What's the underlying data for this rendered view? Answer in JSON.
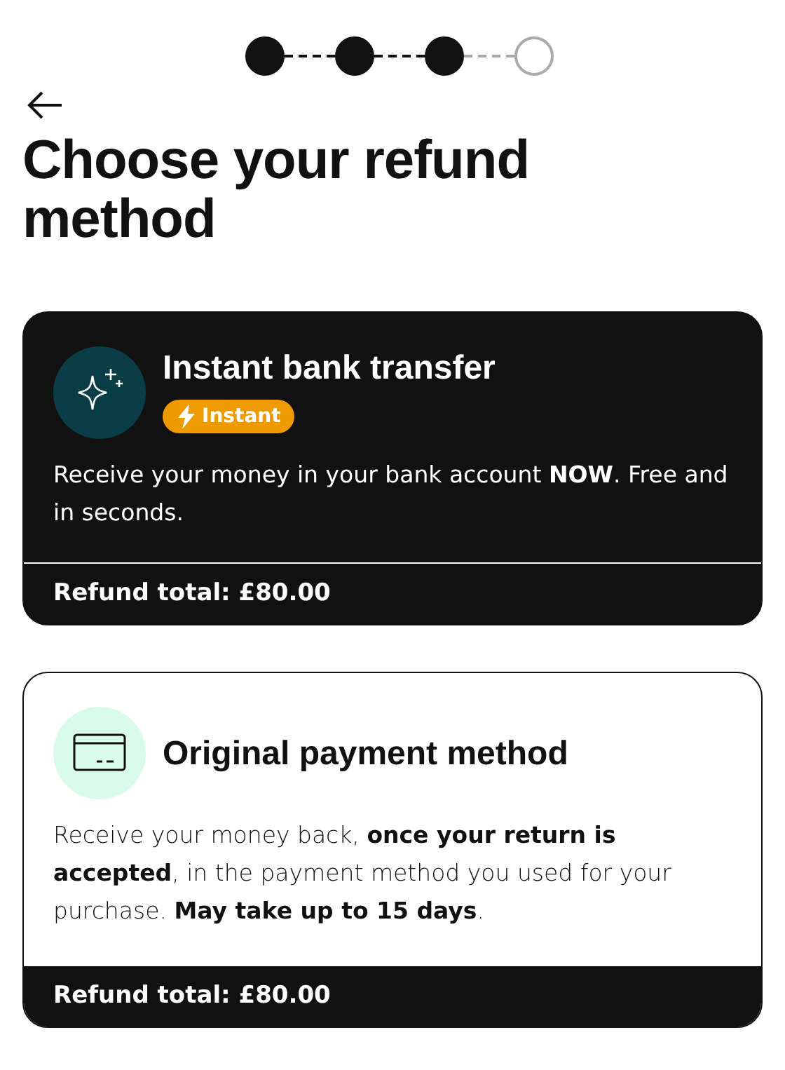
{
  "steps": [
    {
      "done": true
    },
    {
      "done": true
    },
    {
      "done": true
    },
    {
      "done": false
    }
  ],
  "title": "Choose your refund method",
  "options": [
    {
      "kind": "instant",
      "selected": true,
      "title": "Instant bank transfer",
      "badge": "Instant",
      "description": "Receive your money in your bank account **NOW**. Free and in seconds.",
      "total": "Refund total: £80.00"
    },
    {
      "kind": "card",
      "selected": false,
      "title": "Original payment method",
      "description": "Receive your money back, **once your return is accepted**, in the payment method you used for your purchase. **May take up to 15 days**.",
      "total": "Refund total: £80.00"
    }
  ]
}
